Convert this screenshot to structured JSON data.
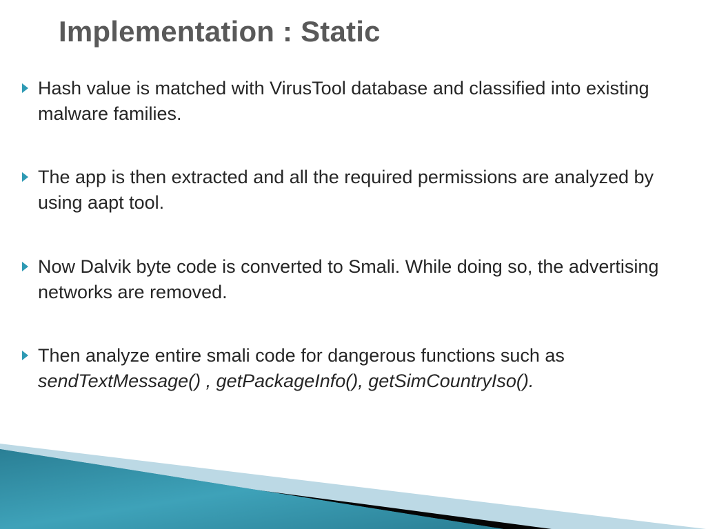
{
  "title": "Implementation : Static",
  "bullets": [
    {
      "text": "Hash value is matched with VirusTool database and classified into existing malware families."
    },
    {
      "text": "The app is then extracted and all the required permissions are analyzed by using aapt tool."
    },
    {
      "text": "Now Dalvik byte code is converted to Smali. While doing so, the advertising networks are removed."
    },
    {
      "parts": [
        "Then analyze entire smali code for dangerous functions such as ",
        "sendTextMessage() , getPackageInfo(), getSimCountryIso()."
      ]
    }
  ],
  "accent_color": "#2e9ab4",
  "title_color": "#595959"
}
